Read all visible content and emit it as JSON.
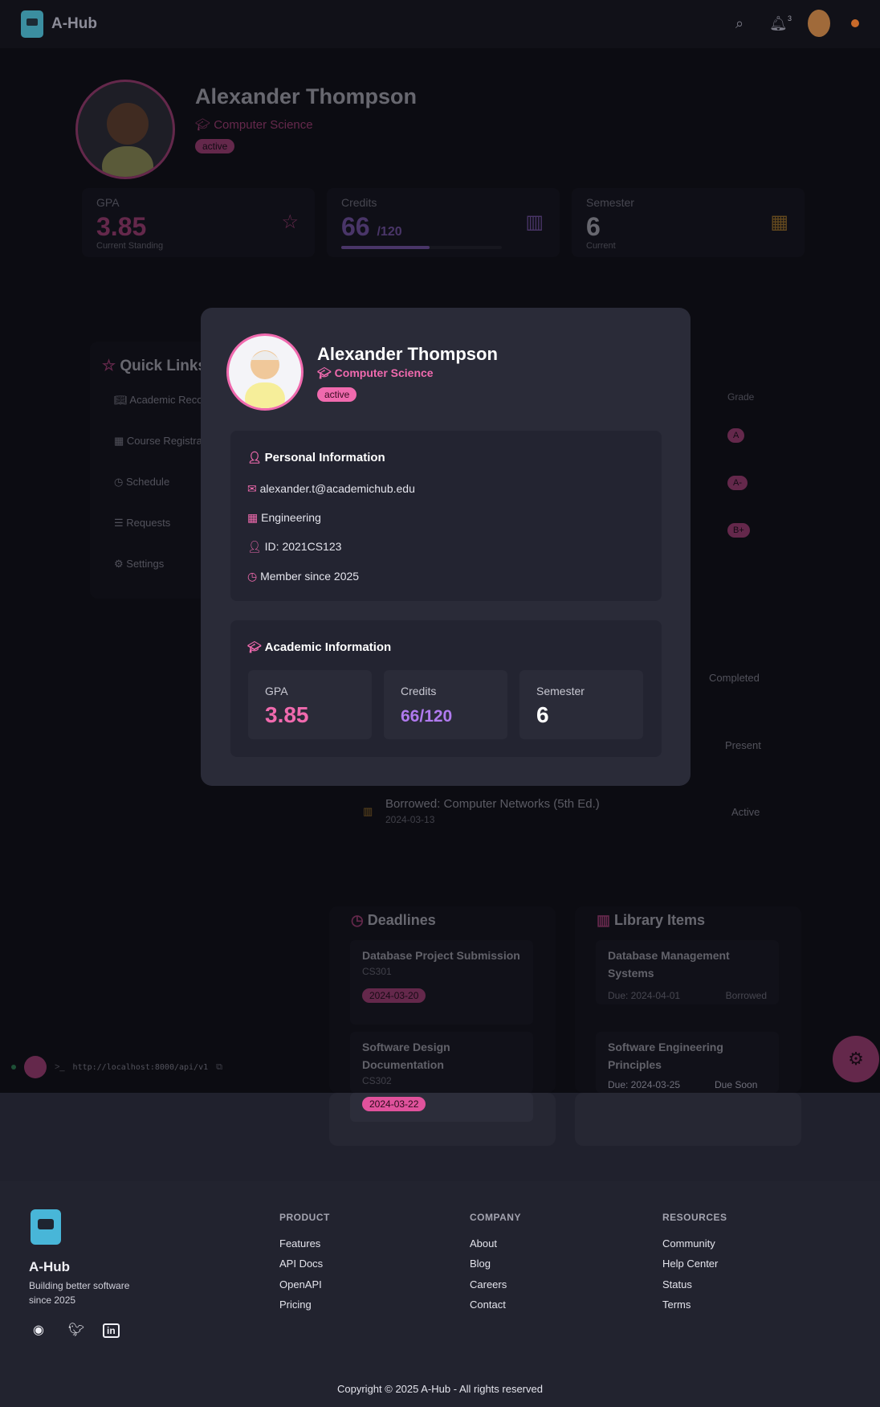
{
  "app": {
    "brand": "A-Hub",
    "notifications": "3"
  },
  "profile": {
    "name": "Alexander Thompson",
    "department": "Computer Science",
    "status": "active",
    "stats": [
      {
        "label": "GPA",
        "value": "3.85",
        "sub": "Current Standing"
      },
      {
        "label": "Credits",
        "value": "66",
        "value_suffix": "/120",
        "sub": "",
        "progress": 0.55
      },
      {
        "label": "Semester",
        "value": "6",
        "sub": "Current"
      }
    ]
  },
  "quick_links": {
    "title": "Quick Links",
    "items": [
      "Academic Records",
      "Course Registration",
      "Schedule",
      "Requests",
      "Settings"
    ]
  },
  "grades": {
    "header": "Grade",
    "values": [
      "A",
      "A-",
      "B+"
    ]
  },
  "activity": {
    "statuses": [
      "Completed",
      "Present",
      "Active"
    ],
    "borrowed_title": "Borrowed: Computer Networks (5th Ed.)",
    "borrowed_date": "2024-03-13"
  },
  "deadlines": {
    "title": "Deadlines",
    "items": [
      {
        "title": "Database Project Submission",
        "code": "CS301",
        "date": "2024-03-20"
      },
      {
        "title": "Software Design Documentation",
        "code": "CS302",
        "date": "2024-03-22"
      }
    ]
  },
  "library": {
    "title": "Library Items",
    "items": [
      {
        "title": "Database Management Systems",
        "due": "Due: 2024-04-01",
        "status": "Borrowed"
      },
      {
        "title": "Software Engineering Principles",
        "due": "Due: 2024-03-25",
        "status": "Due Soon"
      }
    ]
  },
  "api": {
    "url": "http://localhost:8000/api/v1"
  },
  "modal": {
    "name": "Alexander Thompson",
    "department": "Computer Science",
    "status": "active",
    "personal_title": "Personal Information",
    "email": "alexander.t@academichub.edu",
    "faculty": "Engineering",
    "student_id": "ID: 2021CS123",
    "member_since": "Member since 2025",
    "academic_title": "Academic Information",
    "stats": [
      {
        "label": "GPA",
        "value": "3.85",
        "color": "#f06aae"
      },
      {
        "label": "Credits",
        "value": "66/120",
        "color": "#b07aee"
      },
      {
        "label": "Semester",
        "value": "6",
        "color": "#ffffff"
      }
    ]
  },
  "footer": {
    "brand": "A-Hub",
    "tagline": "Building better software since 2025",
    "columns": [
      {
        "heading": "PRODUCT",
        "links": [
          "Features",
          "API Docs",
          "OpenAPI",
          "Pricing"
        ]
      },
      {
        "heading": "COMPANY",
        "links": [
          "About",
          "Blog",
          "Careers",
          "Contact"
        ]
      },
      {
        "heading": "RESOURCES",
        "links": [
          "Community",
          "Help Center",
          "Status",
          "Terms"
        ]
      }
    ],
    "copyright": "Copyright © 2025 A-Hub - All rights reserved"
  },
  "colors": {
    "accent": "#f06aae",
    "credits": "#b07aee",
    "background": "#0c0c12"
  }
}
